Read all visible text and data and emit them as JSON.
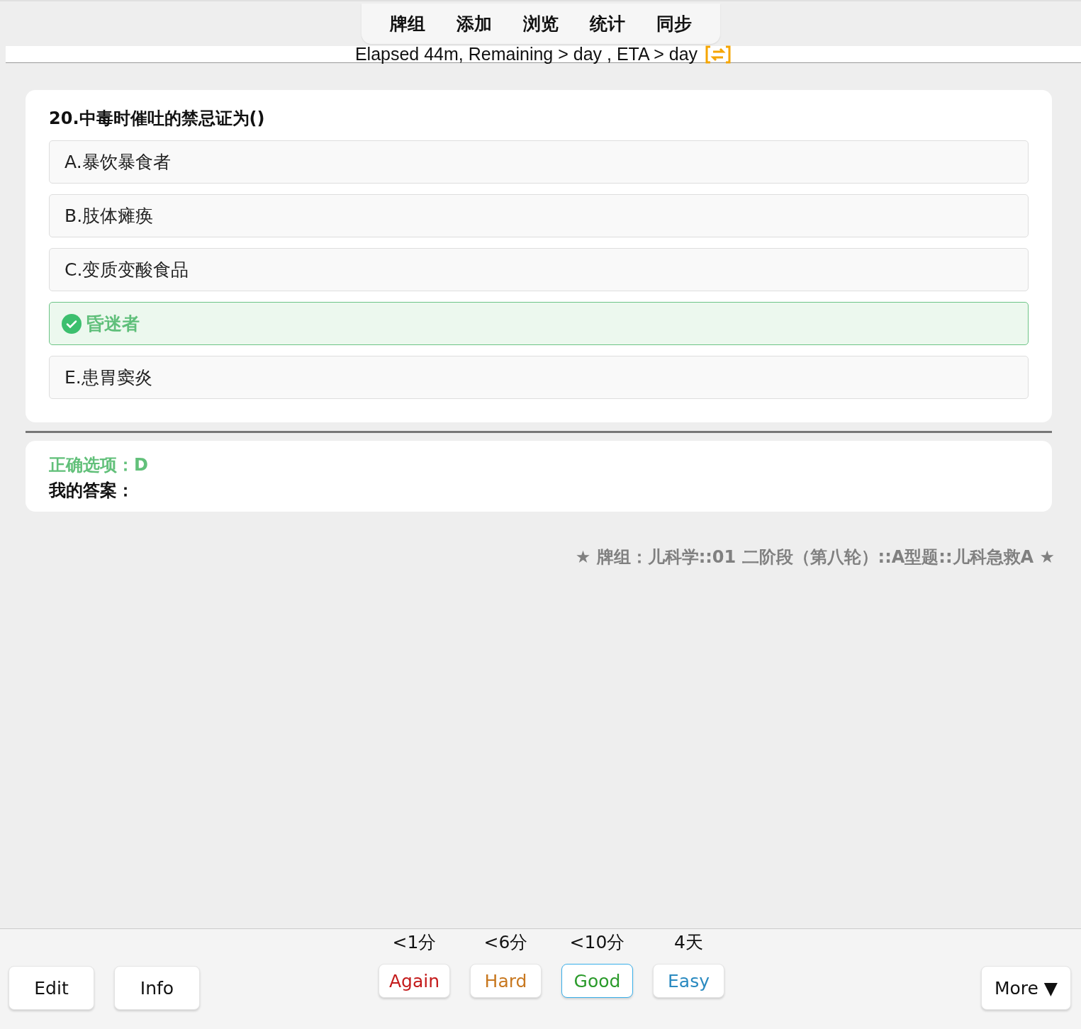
{
  "nav": {
    "items": [
      "牌组",
      "添加",
      "浏览",
      "统计",
      "同步"
    ]
  },
  "status": {
    "text": "Elapsed 44m, Remaining > day , ETA > day"
  },
  "question": {
    "title": "20.中毒时催吐的禁忌证为()",
    "options": [
      {
        "text": "A.暴饮暴食者",
        "correct": false
      },
      {
        "text": "B.肢体瘫痪",
        "correct": false
      },
      {
        "text": "C.变质变酸食品",
        "correct": false
      },
      {
        "text": "昏迷者",
        "correct": true
      },
      {
        "text": "E.患胃窦炎",
        "correct": false
      }
    ]
  },
  "answer": {
    "correct_line": "正确选项：D",
    "mine_line": "我的答案："
  },
  "deck": {
    "text": "★ 牌组：儿科学::01 二阶段（第八轮）::A型题::儿科急救A ★"
  },
  "bottom": {
    "left_buttons": [
      "Edit",
      "Info"
    ],
    "ease": [
      {
        "interval": "<1分",
        "label": "Again",
        "color": "#c41a1a",
        "selected": false
      },
      {
        "interval": "<6分",
        "label": "Hard",
        "color": "#c87820",
        "selected": false
      },
      {
        "interval": "<10分",
        "label": "Good",
        "color": "#2a9a2a",
        "selected": true
      },
      {
        "interval": "4天",
        "label": "Easy",
        "color": "#2a8ac0",
        "selected": false
      }
    ],
    "more": {
      "label": "More ▼"
    }
  }
}
